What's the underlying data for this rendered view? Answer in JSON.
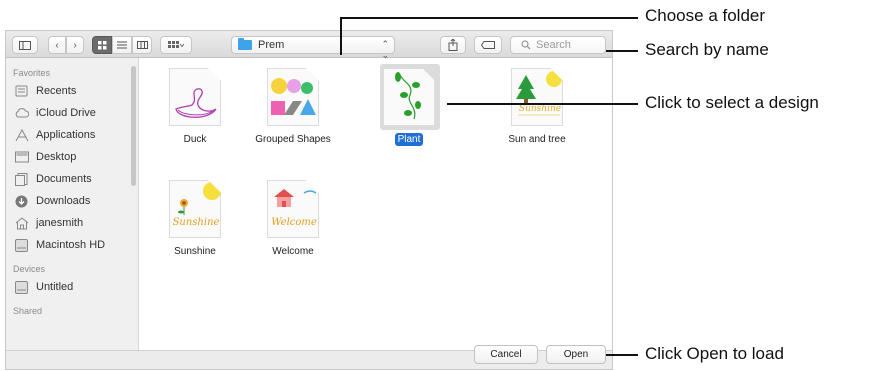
{
  "toolbar": {
    "path_label": "Prem",
    "search_placeholder": "Search"
  },
  "sidebar": {
    "favorites_heading": "Favorites",
    "favorites": [
      {
        "label": "Recents",
        "icon": "recents-icon"
      },
      {
        "label": "iCloud Drive",
        "icon": "cloud-icon"
      },
      {
        "label": "Applications",
        "icon": "applications-icon"
      },
      {
        "label": "Desktop",
        "icon": "desktop-icon"
      },
      {
        "label": "Documents",
        "icon": "documents-icon"
      },
      {
        "label": "Downloads",
        "icon": "downloads-icon"
      },
      {
        "label": "janesmith",
        "icon": "home-icon"
      },
      {
        "label": "Macintosh HD",
        "icon": "disk-icon"
      }
    ],
    "devices_heading": "Devices",
    "devices": [
      {
        "label": "Untitled",
        "icon": "disk-icon"
      }
    ],
    "shared_heading": "Shared"
  },
  "files": [
    {
      "name": "Duck",
      "selected": false
    },
    {
      "name": "Grouped Shapes",
      "selected": false
    },
    {
      "name": "Plant",
      "selected": true
    },
    {
      "name": "Sun and tree",
      "selected": false
    },
    {
      "name": "Sunshine",
      "selected": false
    },
    {
      "name": "Welcome",
      "selected": false
    }
  ],
  "thumb_text": {
    "sunshine": "Sunshine",
    "sunshine_small": "Sunshine",
    "welcome": "Welcome"
  },
  "footer": {
    "cancel_label": "Cancel",
    "open_label": "Open"
  },
  "callouts": {
    "folder": "Choose a folder",
    "search": "Search by name",
    "select": "Click to select a design",
    "open": "Click Open to load"
  }
}
